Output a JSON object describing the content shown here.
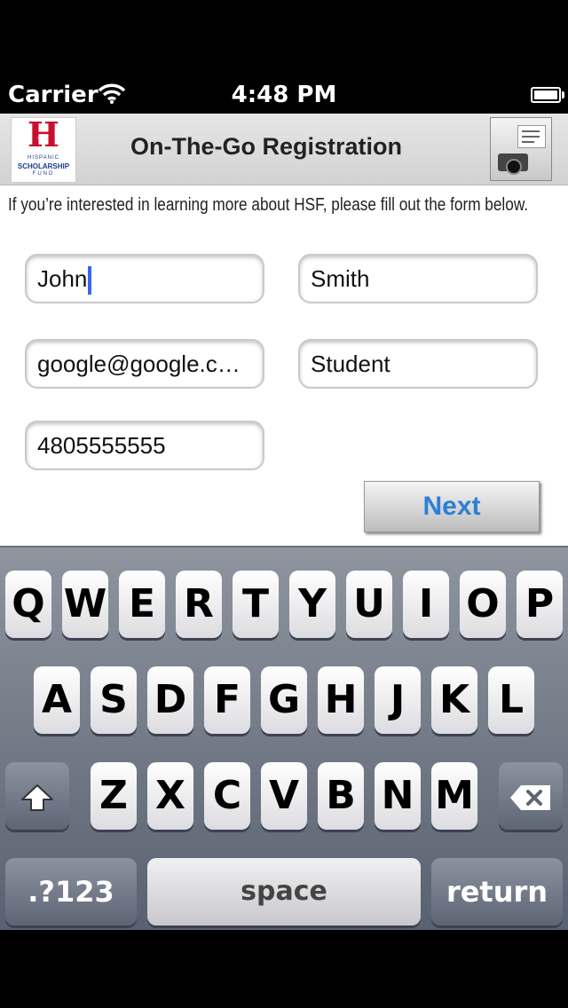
{
  "status_bar": {
    "carrier": "Carrier",
    "time": "4:48 PM"
  },
  "header": {
    "title": "On-The-Go Registration",
    "logo": {
      "letter": "H",
      "line1": "HISPANIC",
      "line2": "SCHOLARSHIP",
      "line3": "FUND"
    }
  },
  "intro_text": "If you’re interested in learning more about HSF, please fill out the form below.",
  "form": {
    "first_name": "John",
    "last_name": "Smith",
    "email": "google@google.c…",
    "role": "Student",
    "phone": "4805555555"
  },
  "next_label": "Next",
  "keyboard": {
    "row1": [
      "Q",
      "W",
      "E",
      "R",
      "T",
      "Y",
      "U",
      "I",
      "O",
      "P"
    ],
    "row2": [
      "A",
      "S",
      "D",
      "F",
      "G",
      "H",
      "J",
      "K",
      "L"
    ],
    "row3": [
      "Z",
      "X",
      "C",
      "V",
      "B",
      "N",
      "M"
    ],
    "numbers_label": ".?123",
    "space_label": "space",
    "return_label": "return"
  },
  "colors": {
    "accent": "#2d7fd6",
    "brand_red": "#c8102e",
    "cursor": "#3a64f0"
  }
}
